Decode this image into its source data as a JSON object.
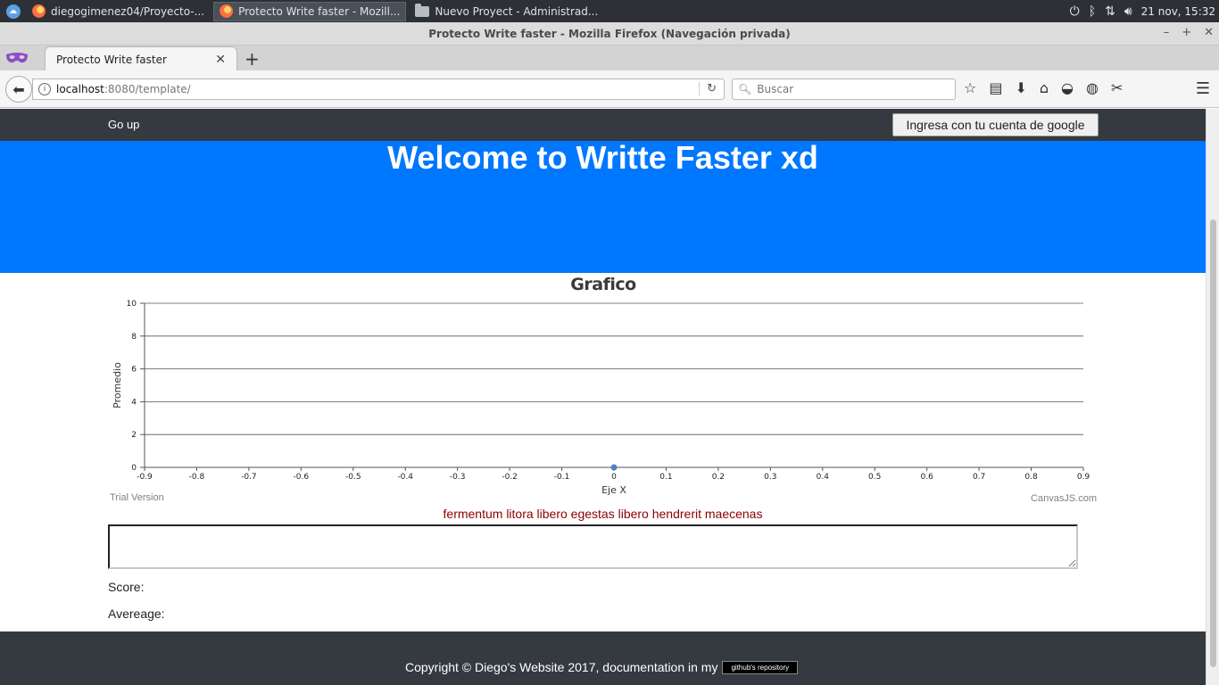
{
  "taskbar": {
    "tasks": [
      {
        "label": "diegogimenez04/Proyecto-..."
      },
      {
        "label": "Protecto Write faster - Mozill..."
      },
      {
        "label": "Nuevo Proyect - Administrad..."
      }
    ],
    "clock": "21 nov, 15:32"
  },
  "browser": {
    "window_title": "Protecto Write faster - Mozilla Firefox (Navegación privada)",
    "tab_title": "Protecto Write faster",
    "url_host": "localhost",
    "url_rest": ":8080/template/",
    "search_placeholder": "Buscar"
  },
  "site": {
    "nav_link": "Go up",
    "google_button": "Ingresa con tu cuenta de google",
    "hero_title": "Welcome to Writte Faster xd",
    "phrase": "fermentum litora libero egestas libero hendrerit maecenas",
    "score_label": "Score:",
    "average_label": "Avereage:",
    "footer_text": "Copyright © Diego's Website 2017, documentation in my",
    "footer_button": "github's repository",
    "trial_text": "Trial Version",
    "canvasjs_text": "CanvasJS.com"
  },
  "chart_data": {
    "type": "line",
    "title": "Grafico",
    "xlabel": "Eje X",
    "ylabel": "Promedio",
    "xlim": [
      -0.9,
      0.9
    ],
    "ylim": [
      0,
      10
    ],
    "x_ticks": [
      "-0.9",
      "-0.8",
      "-0.7",
      "-0.6",
      "-0.5",
      "-0.4",
      "-0.3",
      "-0.2",
      "-0.1",
      "0",
      "0.1",
      "0.2",
      "0.3",
      "0.4",
      "0.5",
      "0.6",
      "0.7",
      "0.8",
      "0.9"
    ],
    "y_ticks": [
      "0",
      "2",
      "4",
      "6",
      "8",
      "10"
    ],
    "grid": true,
    "series": [
      {
        "points": [
          {
            "x": 0,
            "y": 0
          }
        ],
        "color": "#4f81bc"
      }
    ]
  }
}
